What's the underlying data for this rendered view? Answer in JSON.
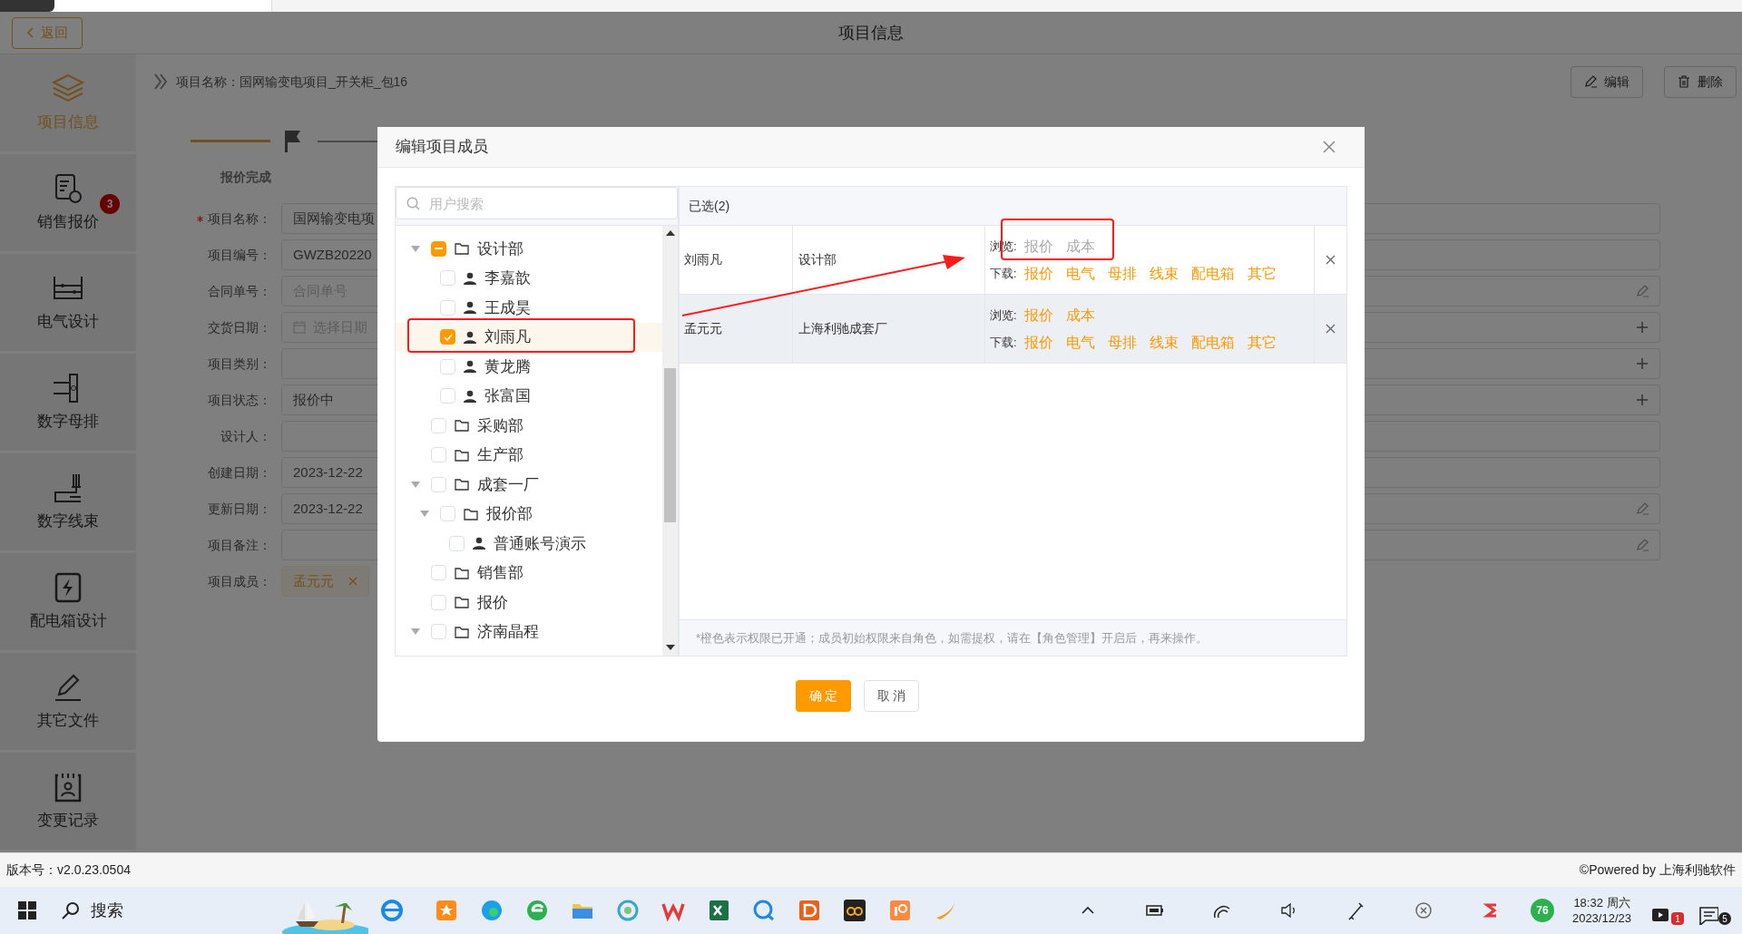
{
  "header": {
    "back": "返回",
    "title": "项目信息"
  },
  "sidebar": [
    {
      "label": "项目信息",
      "selected": true
    },
    {
      "label": "销售报价",
      "selected": false,
      "badge": "3"
    },
    {
      "label": "电气设计",
      "selected": false
    },
    {
      "label": "数字母排",
      "selected": false
    },
    {
      "label": "数字线束",
      "selected": false
    },
    {
      "label": "配电箱设计",
      "selected": false
    },
    {
      "label": "其它文件",
      "selected": false
    },
    {
      "label": "变更记录",
      "selected": false
    }
  ],
  "breadcrumb": "项目名称：国网输变电项目_开关柜_包16",
  "actions": [
    {
      "kind": "edit",
      "label": "编辑"
    },
    {
      "kind": "delete",
      "label": "删除"
    }
  ],
  "step": {
    "label": "报价完成"
  },
  "form": [
    {
      "label": "项目名称：",
      "required": true,
      "value": "国网输变电项"
    },
    {
      "label": "项目编号：",
      "required": false,
      "value": "GWZB20220"
    },
    {
      "label": "合同单号：",
      "required": false,
      "placeholder": "合同单号",
      "editable": true
    },
    {
      "label": "交货日期：",
      "required": false,
      "placeholder": "选择日期",
      "kind": "date",
      "addable": true
    },
    {
      "label": "项目类别：",
      "required": false,
      "addable": true
    },
    {
      "label": "项目状态：",
      "required": false,
      "value": "报价中",
      "addable": true
    },
    {
      "label": "设计人：",
      "required": false
    },
    {
      "label": "创建日期：",
      "required": false,
      "value": "2023-12-22"
    },
    {
      "label": "更新日期：",
      "required": false,
      "value": "2023-12-22",
      "editable": true
    },
    {
      "label": "项目备注：",
      "required": false,
      "editable": true
    },
    {
      "label": "项目成员：",
      "required": false,
      "kind": "tags",
      "tags": [
        "孟元元"
      ]
    }
  ],
  "modal": {
    "title": "编辑项目成员",
    "search": {
      "placeholder": "用户搜索"
    },
    "tree": [
      {
        "label": "设计部",
        "kind": "department",
        "checked": false,
        "partial": true,
        "selected": false,
        "expanded": true,
        "children": [
          {
            "label": "李嘉歆",
            "kind": "user",
            "checked": false,
            "partial": false,
            "selected": false
          },
          {
            "label": "王成昊",
            "kind": "user",
            "checked": false,
            "partial": false,
            "selected": false
          },
          {
            "label": "刘雨凡",
            "kind": "user",
            "checked": true,
            "partial": false,
            "selected": true
          },
          {
            "label": "黄龙腾",
            "kind": "user",
            "checked": false,
            "partial": false,
            "selected": false
          },
          {
            "label": "张富国",
            "kind": "user",
            "checked": false,
            "partial": false,
            "selected": false
          }
        ]
      },
      {
        "label": "采购部",
        "kind": "department",
        "checked": false,
        "partial": false,
        "selected": false
      },
      {
        "label": "生产部",
        "kind": "department",
        "checked": false,
        "partial": false,
        "selected": false
      },
      {
        "label": "成套一厂",
        "kind": "department",
        "checked": false,
        "partial": false,
        "selected": false,
        "expanded": true,
        "children": [
          {
            "label": "报价部",
            "kind": "department",
            "checked": false,
            "partial": false,
            "selected": false,
            "expanded": true,
            "children": [
              {
                "label": "普通账号演示",
                "kind": "user",
                "checked": false,
                "partial": false,
                "selected": false
              }
            ]
          }
        ]
      },
      {
        "label": "销售部",
        "kind": "department",
        "checked": false,
        "partial": false,
        "selected": false
      },
      {
        "label": "报价",
        "kind": "department",
        "checked": false,
        "partial": false,
        "selected": false
      },
      {
        "label": "济南晶程",
        "kind": "department",
        "checked": false,
        "partial": false,
        "selected": false,
        "expanded": true
      }
    ],
    "selected_header": "已选(2)",
    "members": [
      {
        "name": "刘雨凡",
        "dept": "设计部",
        "hovered": false,
        "browse_label": "浏览:",
        "browse": [
          {
            "label": "报价",
            "on": false
          },
          {
            "label": "成本",
            "on": false
          }
        ],
        "download_label": "下载:",
        "download": [
          {
            "label": "报价",
            "on": true
          },
          {
            "label": "电气",
            "on": true
          },
          {
            "label": "母排",
            "on": true
          },
          {
            "label": "线束",
            "on": true
          },
          {
            "label": "配电箱",
            "on": true
          },
          {
            "label": "其它",
            "on": true
          }
        ]
      },
      {
        "name": "孟元元",
        "dept": "上海利驰成套厂",
        "hovered": true,
        "browse_label": "浏览:",
        "browse": [
          {
            "label": "报价",
            "on": true
          },
          {
            "label": "成本",
            "on": true
          }
        ],
        "download_label": "下载:",
        "download": [
          {
            "label": "报价",
            "on": true
          },
          {
            "label": "电气",
            "on": true
          },
          {
            "label": "母排",
            "on": true
          },
          {
            "label": "线束",
            "on": true
          },
          {
            "label": "配电箱",
            "on": true
          },
          {
            "label": "其它",
            "on": true
          }
        ]
      }
    ],
    "note": "*橙色表示权限已开通；成员初始权限来自角色，如需提权，请在【角色管理】开启后，再来操作。",
    "buttons": [
      {
        "label": "确 定",
        "primary": true
      },
      {
        "label": "取 消",
        "primary": false
      }
    ]
  },
  "footer": {
    "version": "版本号：v2.0.23.0504",
    "powered": "©Powered by 上海利驰软件"
  },
  "taskbar": {
    "search": "搜索",
    "tray_badge": "76",
    "time": "18:32 周六",
    "date": "2023/12/23",
    "notify_badges": [
      "1",
      "5"
    ]
  }
}
